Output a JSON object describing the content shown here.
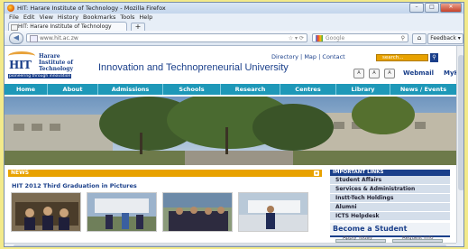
{
  "browser": {
    "window_title": "HIT: Harare Institute of Technology - Mozilla Firefox",
    "menu": [
      "File",
      "Edit",
      "View",
      "History",
      "Bookmarks",
      "Tools",
      "Help"
    ],
    "tab_title": "HIT: Harare Institute of Technology",
    "new_tab": "+",
    "url": "www.hit.ac.zw",
    "search_placeholder": "Google",
    "feedback": "Feedback"
  },
  "site": {
    "logo": {
      "mark": "HIT",
      "name_line1": "Harare",
      "name_line2": "Institute of",
      "name_line3": "Technology",
      "tagline": "pioneering through innovation"
    },
    "slogan": "Innovation and Technopreneurial University",
    "top_links": {
      "directory": "Directory",
      "sep1": "|",
      "map": "Map",
      "sep2": "|",
      "contact": "Contact"
    },
    "search_placeholder": "search...",
    "font_buttons": [
      "A",
      "A",
      "A"
    ],
    "webmail": "Webmail",
    "myhit": "MyHIT"
  },
  "nav": [
    "Home",
    "About",
    "Admissions",
    "Schools",
    "Research",
    "Centres",
    "Library",
    "News / Events"
  ],
  "news": {
    "label": "NEWS",
    "headline": "HIT 2012 Third Graduation in Pictures"
  },
  "important_links": {
    "heading": "IMPORTANT LINKS",
    "items": [
      "Student Affairs",
      "Services & Administration",
      "Instt-Tech Holdings",
      "Alumni",
      "ICTS Helpdesk"
    ]
  },
  "become": {
    "title": "Become a Student",
    "apply": "Apply Today",
    "request": "Request Info"
  },
  "colors": {
    "nav": "#1e98b8",
    "brand": "#1a3f8a",
    "accent": "#e8a200"
  }
}
